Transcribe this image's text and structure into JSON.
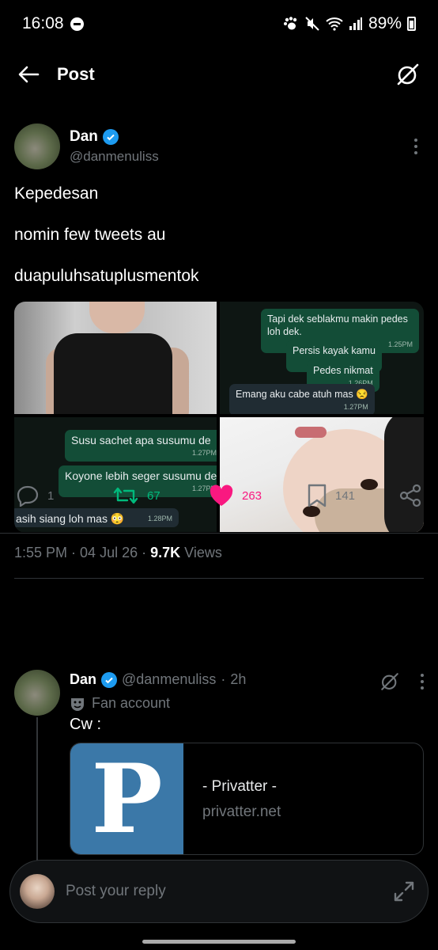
{
  "status_bar": {
    "time": "16:08",
    "battery": "89%"
  },
  "header": {
    "back_icon": "arrow-left-icon",
    "title": "Post",
    "grok_icon": "grok-icon"
  },
  "tweet": {
    "author_name": "Dan",
    "author_handle": "@danmenuliss",
    "lines": [
      "Kepedesan",
      "nomin few tweets au",
      "duapuluhsatuplusmentok"
    ],
    "chat_top": [
      {
        "text": "Tapi dek seblakmu makin pedes loh dek.",
        "time": "1.25PM"
      },
      {
        "text": "Persis kayak kamu",
        "time": "1.26PM"
      },
      {
        "text": "Pedes nikmat",
        "time": "1.26PM"
      },
      {
        "text": "Emang aku cabe atuh mas 😒",
        "time": "1.27PM"
      }
    ],
    "chat_bottom": [
      {
        "text": "Susu sachet apa susumu de",
        "time": "1.27PM"
      },
      {
        "text": "Koyone lebih seger susumu de",
        "time": "1.27PM"
      },
      {
        "text": "asih siang loh mas 😳",
        "time": "1.28PM"
      }
    ],
    "time": "1:55 PM",
    "date": "04 Jul 26",
    "views_count": "9.7K",
    "views_label": "Views",
    "replies": "1",
    "reposts": "67",
    "likes": "263",
    "bookmarks": "141"
  },
  "reply": {
    "author_name": "Dan",
    "author_handle": "@danmenuliss",
    "age": "2h",
    "label": "Fan account",
    "text": "Cw :",
    "card_title": "- Privatter -",
    "card_url": "privatter.net",
    "card_logo_letter": "P"
  },
  "composer": {
    "placeholder": "Post your reply"
  },
  "colors": {
    "like": "#f91880",
    "repost": "#00ba7c",
    "verified": "#1d9bf0",
    "muted": "#71767b"
  }
}
